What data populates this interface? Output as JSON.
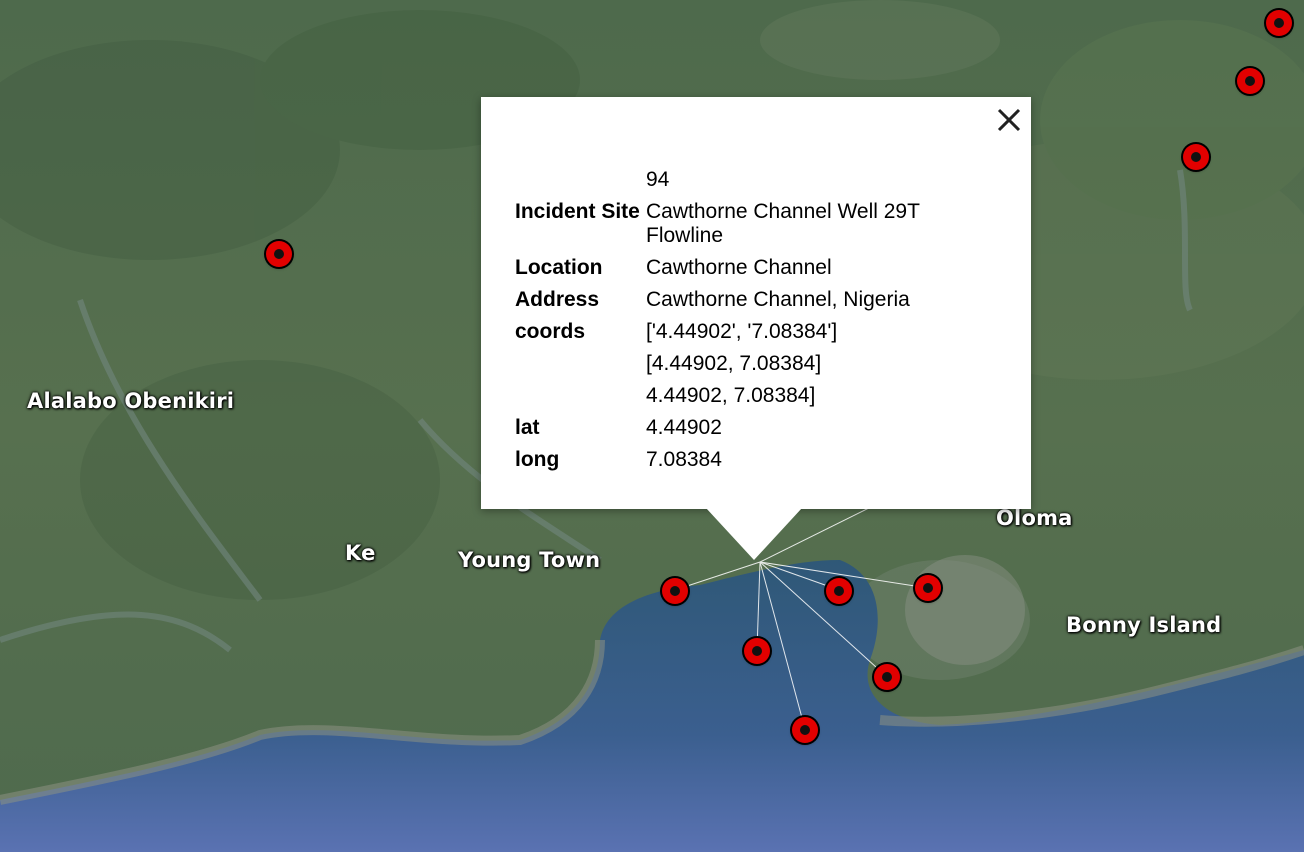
{
  "map": {
    "place_labels": [
      {
        "id": "alalabo-obenikiri",
        "text": "Alalabo Obenikiri"
      },
      {
        "id": "ke",
        "text": "Ke"
      },
      {
        "id": "young-town",
        "text": "Young Town"
      },
      {
        "id": "oloma",
        "text": "Oloma"
      },
      {
        "id": "bonny-island",
        "text": "Bonny Island"
      }
    ],
    "marker_color": "#e20000",
    "marker_icon": "incident-marker-icon"
  },
  "popup": {
    "close_icon": "close-icon",
    "rows": [
      {
        "key": "",
        "value": "94"
      },
      {
        "key": "Incident Site",
        "value": "Cawthorne Channel Well 29T Flowline"
      },
      {
        "key": "Location",
        "value": "Cawthorne Channel"
      },
      {
        "key": "Address",
        "value": "Cawthorne Channel, Nigeria"
      },
      {
        "key": "coords",
        "value": "['4.44902', '7.08384']"
      },
      {
        "key": "",
        "value": "[4.44902, 7.08384]"
      },
      {
        "key": "",
        "value": "4.44902, 7.08384]"
      },
      {
        "key": "lat",
        "value": "4.44902"
      },
      {
        "key": "long",
        "value": "7.08384"
      }
    ]
  }
}
